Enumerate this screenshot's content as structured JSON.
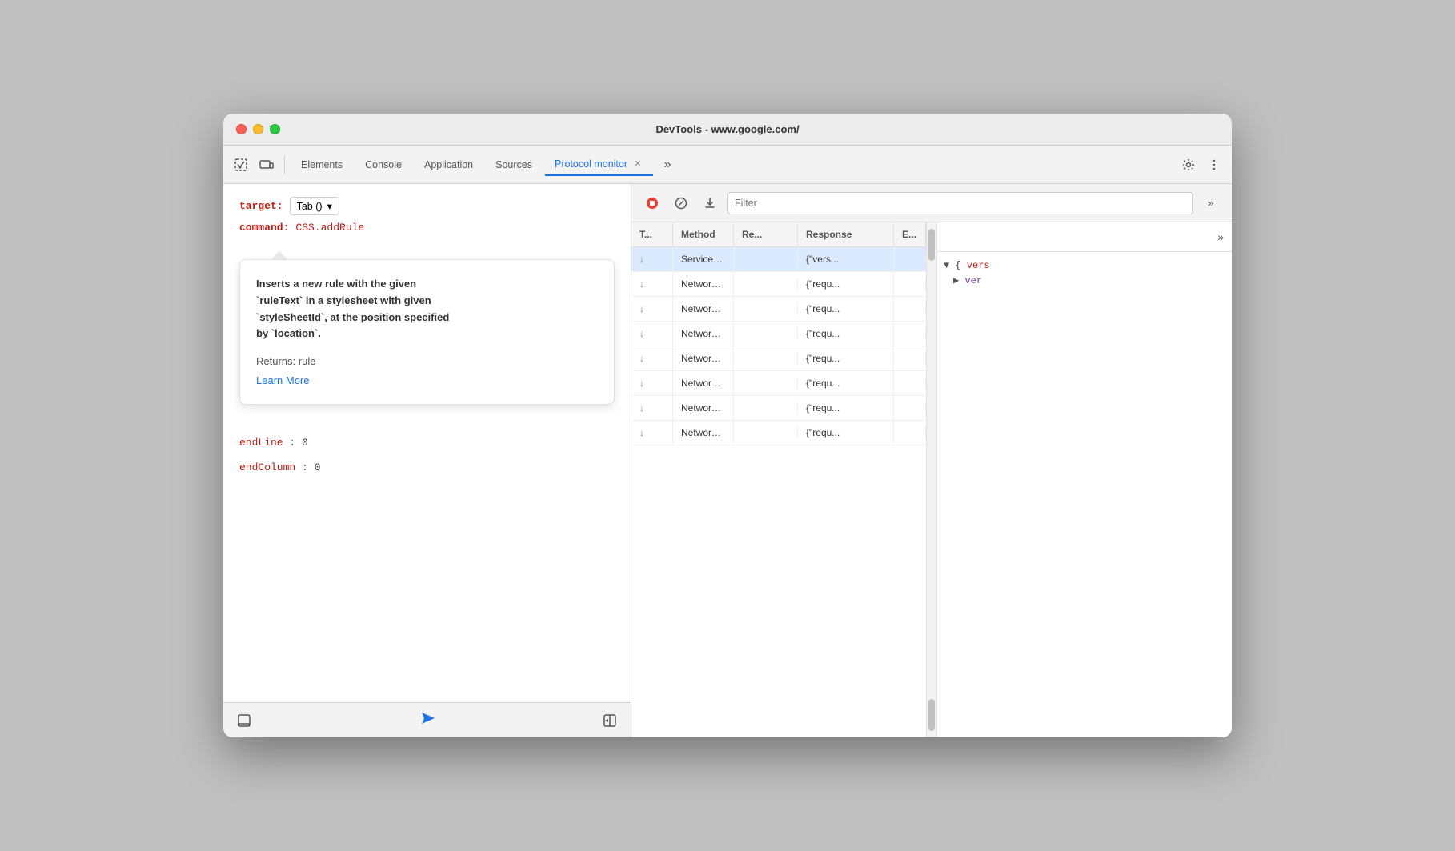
{
  "window": {
    "title": "DevTools - www.google.com/"
  },
  "tabs": [
    {
      "id": "inspect",
      "label": "⬚",
      "icon": true
    },
    {
      "id": "responsive",
      "label": "⊡",
      "icon": true
    },
    {
      "id": "elements",
      "label": "Elements"
    },
    {
      "id": "console",
      "label": "Console"
    },
    {
      "id": "application",
      "label": "Application"
    },
    {
      "id": "sources",
      "label": "Sources"
    },
    {
      "id": "protocol-monitor",
      "label": "Protocol monitor",
      "active": true,
      "closeable": true
    }
  ],
  "toolbar_right": {
    "more_tabs_label": "»",
    "settings_label": "⚙",
    "menu_label": "⋮"
  },
  "left_panel": {
    "target_label": "target:",
    "target_value": "Tab ()",
    "command_label": "command:",
    "command_value": "CSS.addRule",
    "tooltip": {
      "text_parts": [
        "Inserts a new rule with the given `ruleText` in a stylesheet with given `styleSheetId`, at the position specified by `location`."
      ],
      "returns_label": "Returns:",
      "returns_value": "rule",
      "learn_more_label": "Learn More"
    },
    "code_lines": [
      {
        "prop": "endLine",
        "val": "0"
      },
      {
        "prop": "endColumn",
        "val": "0"
      }
    ]
  },
  "bottom_bar": {
    "drawer_icon": "▣",
    "send_icon": "▷",
    "split_icon": "⊣"
  },
  "right_panel": {
    "stop_icon": "⏹",
    "clear_icon": "⊘",
    "download_icon": "⬇",
    "filter_placeholder": "Filter",
    "more_icon": "»",
    "columns": {
      "t": "T...",
      "method": "Method",
      "request": "Re...",
      "response": "Response",
      "error": "E..."
    },
    "rows": [
      {
        "type": "↓",
        "method": "ServiceWo...",
        "request": "",
        "response": "{\"vers...",
        "selected": true
      },
      {
        "type": "↓",
        "method": "Network.re...",
        "request": "",
        "response": "{\"requ...",
        "selected": false
      },
      {
        "type": "↓",
        "method": "Network.re...",
        "request": "",
        "response": "{\"requ...",
        "selected": false
      },
      {
        "type": "↓",
        "method": "Network.re...",
        "request": "",
        "response": "{\"requ...",
        "selected": false
      },
      {
        "type": "↓",
        "method": "Network.re...",
        "request": "",
        "response": "{\"requ...",
        "selected": false
      },
      {
        "type": "↓",
        "method": "Network.lo...",
        "request": "",
        "response": "{\"requ...",
        "selected": false
      },
      {
        "type": "↓",
        "method": "Network.re...",
        "request": "",
        "response": "{\"requ...",
        "selected": false
      },
      {
        "type": "↓",
        "method": "Network.re...",
        "request": "",
        "response": "{\"requ...",
        "selected": false
      }
    ],
    "detail": {
      "expand_icon": "»",
      "json_line1": "▼ {vers",
      "json_line2": "▶ ver"
    }
  }
}
